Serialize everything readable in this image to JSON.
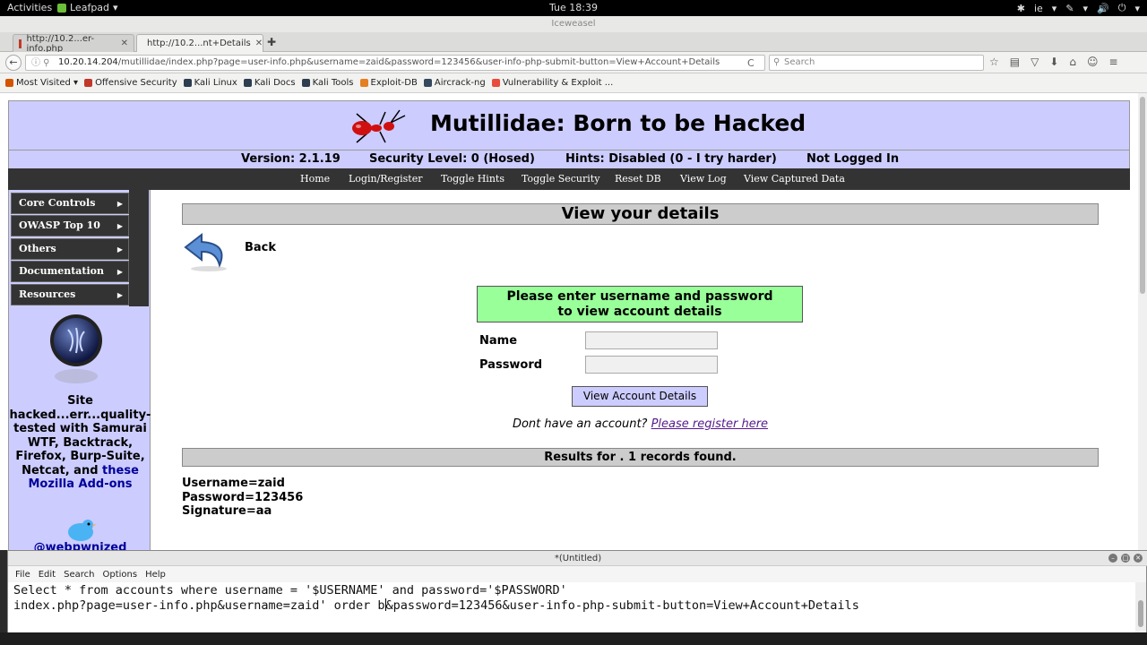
{
  "topbar": {
    "activities": "Activities",
    "app_name": "Leafpad",
    "app_arrow": "▾",
    "clock": "Tue 18:39",
    "tray": [
      "✱",
      "ie",
      "▾",
      "✎",
      "▾",
      "🔊",
      "⏻",
      "▾"
    ]
  },
  "browser": {
    "title": "Iceweasel",
    "tabs": [
      {
        "label": "http://10.2...er-info.php",
        "close": "✕"
      },
      {
        "label": "http://10.2...nt+Details",
        "close": "✕"
      }
    ],
    "new_tab": "✚",
    "back": "←",
    "url_host": "10.20.14.204",
    "url_path": "/mutillidae/index.php?page=user-info.php&username=zaid&password=123456&user-info-php-submit-button=View+Account+Details",
    "reload": "C",
    "search_placeholder": "Search",
    "search_icon": "magnifier-icon",
    "nav_icons": [
      "☆",
      "▤",
      "▽",
      "⬇",
      "⌂",
      "☺",
      "≡"
    ]
  },
  "bookmarks": [
    {
      "label": "Most Visited ▾",
      "color": "#d35400"
    },
    {
      "label": "Offensive Security",
      "color": "#c0392b"
    },
    {
      "label": "Kali Linux",
      "color": "#2c3e50"
    },
    {
      "label": "Kali Docs",
      "color": "#2c3e50"
    },
    {
      "label": "Kali Tools",
      "color": "#2c3e50"
    },
    {
      "label": "Exploit-DB",
      "color": "#e67e22"
    },
    {
      "label": "Aircrack-ng",
      "color": "#34495e"
    },
    {
      "label": "Vulnerability & Exploit ...",
      "color": "#e74c3c"
    }
  ],
  "site": {
    "title": "Mutillidae: Born to be Hacked",
    "version": "Version: 2.1.19",
    "security": "Security Level: 0 (Hosed)",
    "hints": "Hints: Disabled (0 - I try harder)",
    "login_status": "Not Logged In",
    "menu": [
      "Home",
      "Login/Register",
      "Toggle Hints",
      "Toggle Security",
      "Reset DB",
      "View Log",
      "View Captured Data"
    ],
    "sidebar": [
      {
        "label": "Core Controls"
      },
      {
        "label": "OWASP Top 10"
      },
      {
        "label": "Others"
      },
      {
        "label": "Documentation"
      },
      {
        "label": "Resources"
      }
    ],
    "sidebar_arrow": "▶",
    "side_text": "Site hacked...err...quality-tested with Samurai WTF, Backtrack, Firefox, Burp-Suite, Netcat, and",
    "side_link": "these Mozilla Add-ons",
    "side_handle": "@webpwnized"
  },
  "content": {
    "panel_title": "View your details",
    "back_label": "Back",
    "form_hint_line1": "Please enter username and password",
    "form_hint_line2": "to view account details",
    "name_label": "Name",
    "password_label": "Password",
    "submit_label": "View Account Details",
    "register_text": "Dont have an account?",
    "register_link": "Please register here",
    "results": "Results for . 1 records found.",
    "username_line": "Username=zaid",
    "password_line": "Password=123456",
    "signature_line": "Signature=aa"
  },
  "leafpad": {
    "title": "*(Untitled)",
    "menu": [
      "File",
      "Edit",
      "Search",
      "Options",
      "Help"
    ],
    "line1": "Select * from accounts where username = '$USERNAME' and password='$PASSWORD'",
    "line2_before": "index.php?page=user-info.php&username=zaid' order b",
    "line2_after": "&password=123456&user-info-php-submit-button=View+Account+Details"
  }
}
